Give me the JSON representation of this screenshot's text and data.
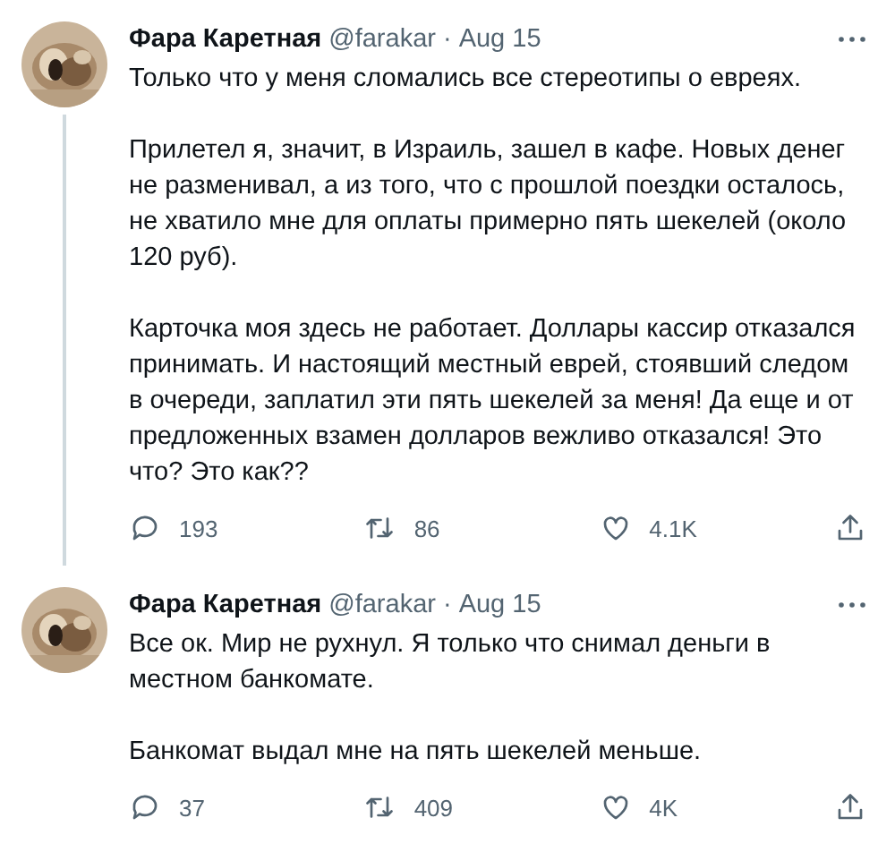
{
  "tweets": [
    {
      "author": "Фара Каретная",
      "handle": "@farakar",
      "separator": "·",
      "date": "Aug 15",
      "paragraphs": [
        "Только что у меня сломались все стереотипы о евреях.",
        "Прилетел я, значит, в Израиль, зашел в кафе. Новых денег не разменивал, а из того, что с прошлой поездки осталось, не хватило мне для оплаты примерно пять шекелей (около 120 руб).",
        "Карточка моя здесь не работает. Доллары кассир отказался принимать. И настоящий местный еврей, стоявший следом в очереди, заплатил эти пять шекелей за меня! Да еще и от предложенных взамен долларов вежливо отказался! Это что? Это как??"
      ],
      "replies": "193",
      "retweets": "86",
      "likes": "4.1K"
    },
    {
      "author": "Фара Каретная",
      "handle": "@farakar",
      "separator": "·",
      "date": "Aug 15",
      "paragraphs": [
        "Все ок. Мир не рухнул. Я только что снимал деньги в местном банкомате.",
        "Банкомат выдал мне на пять шекелей меньше."
      ],
      "replies": "37",
      "retweets": "409",
      "likes": "4K"
    }
  ]
}
